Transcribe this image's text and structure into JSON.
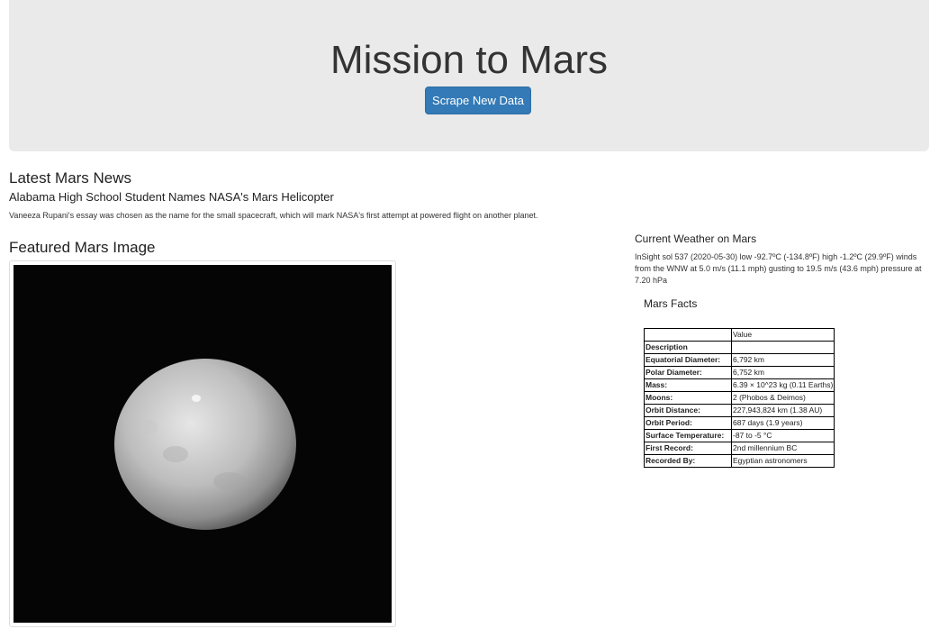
{
  "header": {
    "title": "Mission to Mars",
    "scrape_button": "Scrape New Data"
  },
  "news": {
    "section_title": "Latest Mars News",
    "headline": "Alabama High School Student Names NASA's Mars Helicopter",
    "teaser": "Vaneeza Rupani's essay was chosen as the name for the small spacecraft, which will mark NASA's first attempt at powered flight on another planet."
  },
  "featured_image": {
    "section_title": "Featured Mars Image"
  },
  "weather": {
    "section_title": "Current Weather on Mars",
    "text": "InSight sol 537 (2020-05-30) low -92.7ºC (-134.8ºF) high -1.2ºC (29.9ºF) winds from the WNW at 5.0 m/s (11.1 mph) gusting to 19.5 m/s (43.6 mph) pressure at 7.20 hPa"
  },
  "facts": {
    "section_title": "Mars Facts",
    "column_header": "Value",
    "index_header": "Description",
    "rows": [
      {
        "label": "Equatorial Diameter:",
        "value": "6,792 km"
      },
      {
        "label": "Polar Diameter:",
        "value": "6,752 km"
      },
      {
        "label": "Mass:",
        "value": "6.39 × 10^23 kg (0.11 Earths)"
      },
      {
        "label": "Moons:",
        "value": "2 (Phobos & Deimos)"
      },
      {
        "label": "Orbit Distance:",
        "value": "227,943,824 km (1.38 AU)"
      },
      {
        "label": "Orbit Period:",
        "value": "687 days (1.9 years)"
      },
      {
        "label": "Surface Temperature:",
        "value": "-87 to -5 °C"
      },
      {
        "label": "First Record:",
        "value": "2nd millennium BC"
      },
      {
        "label": "Recorded By:",
        "value": "Egyptian astronomers"
      }
    ]
  },
  "colors": {
    "jumbotron_bg": "#eaeaea",
    "button_primary": "#337ab7"
  }
}
